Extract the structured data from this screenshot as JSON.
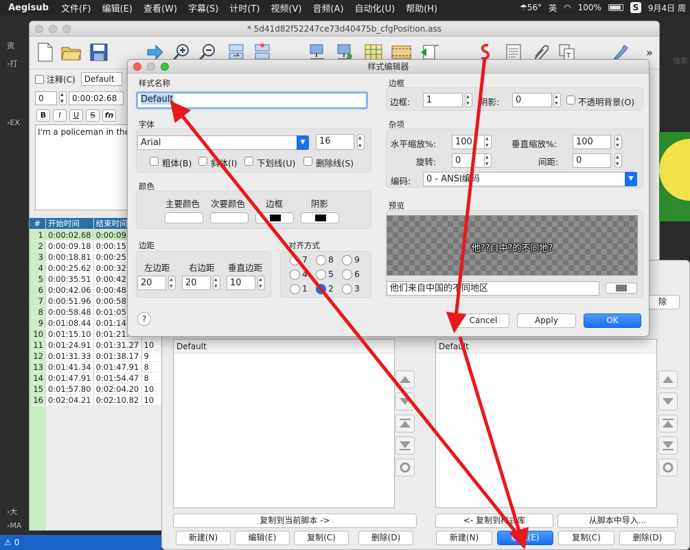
{
  "menubar": {
    "app": "Aegisub",
    "items": [
      "文件(F)",
      "编辑(E)",
      "查看(W)",
      "字幕(S)",
      "计时(T)",
      "视频(V)",
      "音频(A)",
      "自动化(U)",
      "帮助(H)"
    ],
    "temp": "56°",
    "ime": "英",
    "battery": "100%",
    "date": "9月4日 周"
  },
  "background": {
    "left_labels": [
      "资",
      "打",
      "EX",
      "大",
      "MA"
    ],
    "right_search": "搜索"
  },
  "main_window": {
    "title": "* 5d41d82f52247ce73d40475b_cfgPosition.ass",
    "toolbar_more": "»",
    "comment_label": "注释(C)",
    "style_value": "Default",
    "layer_value": "0",
    "time_value": "0:00:02.68",
    "format_buttons": [
      "B",
      "I",
      "U",
      "S",
      "fn"
    ],
    "subtitle_text": "I'm a policeman in the"
  },
  "grid": {
    "headers": [
      "#",
      "开始时间",
      "结束时间"
    ],
    "rows": [
      {
        "n": "1",
        "start": "0:00:02.68",
        "end": "0:00:09."
      },
      {
        "n": "2",
        "start": "0:00:09.18",
        "end": "0:00:15."
      },
      {
        "n": "3",
        "start": "0:00:18.81",
        "end": "0:00:25."
      },
      {
        "n": "4",
        "start": "0:00:25.62",
        "end": "0:00:32."
      },
      {
        "n": "5",
        "start": "0:00:35.51",
        "end": "0:00:42."
      },
      {
        "n": "6",
        "start": "0:00:42.06",
        "end": "0:00:48."
      },
      {
        "n": "7",
        "start": "0:00:51.96",
        "end": "0:00:58."
      },
      {
        "n": "8",
        "start": "0:00:58.48",
        "end": "0:01:05."
      },
      {
        "n": "9",
        "start": "0:01:08.44",
        "end": "0:01:14."
      },
      {
        "n": "10",
        "start": "0:01:15.10",
        "end": "0:01:21."
      },
      {
        "n": "11",
        "start": "0:01:24.91",
        "end": "0:01:31.27",
        "cps": "10"
      },
      {
        "n": "12",
        "start": "0:01:31.33",
        "end": "0:01:38.17",
        "cps": "9"
      },
      {
        "n": "13",
        "start": "0:01:41.34",
        "end": "0:01:47.91",
        "cps": "8"
      },
      {
        "n": "14",
        "start": "0:01:47.91",
        "end": "0:01:54.47",
        "cps": "8"
      },
      {
        "n": "15",
        "start": "0:01:57.80",
        "end": "0:02:04.20",
        "cps": "10"
      },
      {
        "n": "16",
        "start": "0:02:04.21",
        "end": "0:02:10.82",
        "cps": "10"
      }
    ]
  },
  "style_manager": {
    "left_list_item": "Default",
    "right_list_item": "Default",
    "partial_button": "除",
    "copy_to_script": "复制到当前脚本 ->",
    "copy_to_storage": "<- 复制到样式库",
    "import_from_script": "从脚本中导入...",
    "left_buttons": [
      "新建(N)",
      "编辑(E)",
      "复制(C)",
      "删除(D)"
    ],
    "right_buttons": [
      "新建(N)",
      "编辑(E)",
      "复制(C)",
      "删除(D)"
    ]
  },
  "style_editor": {
    "title": "样式编辑器",
    "style_name_label": "样式名称",
    "style_name_value": "Default",
    "font_label": "字体",
    "font_name": "Arial",
    "font_size": "16",
    "bold": "粗体(B)",
    "italic": "斜体(I)",
    "underline": "下划线(U)",
    "strikeout": "删除线(S)",
    "colors_label": "颜色",
    "primary": "主要颜色",
    "secondary": "次要颜色",
    "outline_color": "边框",
    "shadow_color": "阴影",
    "margins_label": "边距",
    "margin_left_label": "左边距",
    "margin_right_label": "右边距",
    "margin_vert_label": "垂直边距",
    "margin_left": "20",
    "margin_right": "20",
    "margin_vert": "10",
    "alignment_label": "对齐方式",
    "alignment_options": [
      "7",
      "8",
      "9",
      "4",
      "5",
      "6",
      "1",
      "2",
      "3"
    ],
    "alignment_selected": "2",
    "border_label": "边框",
    "outline_label": "边框:",
    "outline_value": "1",
    "shadow_label": "阴影:",
    "shadow_value": "0",
    "opaque_box": "不透明背景(O)",
    "misc_label": "杂项",
    "scale_x_label": "水平缩放%:",
    "scale_x": "100",
    "scale_y_label": "垂直缩放%:",
    "scale_y": "100",
    "rotation_label": "旋转:",
    "rotation": "0",
    "spacing_label": "间距:",
    "spacing": "0",
    "encoding_label": "编码:",
    "encoding_value": "0 - ANSI编码",
    "preview_label": "预览",
    "preview_text": "他??自中?的不同地?",
    "preview_input": "他们来自中国的不同地区",
    "help": "?",
    "cancel": "Cancel",
    "apply": "Apply",
    "ok": "OK"
  },
  "statusbar": {
    "warning": "0"
  },
  "colors": {
    "accent_blue": "#1a70f0",
    "annotation_red": "#e8191c",
    "grid_selected": "#c9edc4"
  }
}
